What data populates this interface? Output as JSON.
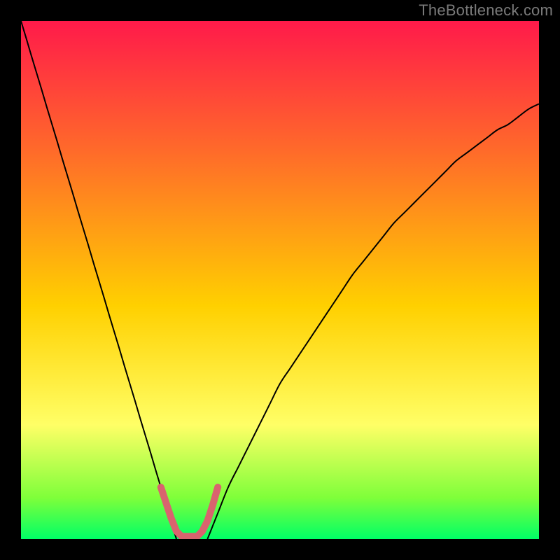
{
  "attribution": "TheBottleneck.com",
  "chart_data": {
    "type": "line",
    "title": "",
    "xlabel": "",
    "ylabel": "",
    "xlim": [
      0,
      100
    ],
    "ylim": [
      0,
      100
    ],
    "grid": false,
    "legend": false,
    "background_gradient": [
      "#ff1a4a",
      "#ff6a2a",
      "#ffd000",
      "#ffff66",
      "#7fff3a",
      "#00ff66"
    ],
    "series": [
      {
        "name": "left-branch",
        "stroke": "#000000",
        "width": 2,
        "x": [
          0,
          1,
          2,
          3,
          4,
          5,
          6,
          7,
          8,
          9,
          10,
          11,
          12,
          13,
          14,
          15,
          16,
          17,
          18,
          19,
          20,
          21,
          22,
          23,
          24,
          25,
          26,
          27,
          28,
          29,
          30
        ],
        "y": [
          100,
          96.7,
          93.3,
          90,
          86.7,
          83.3,
          80,
          76.7,
          73.3,
          70,
          66.7,
          63.3,
          60,
          56.7,
          53.3,
          50,
          46.7,
          43.3,
          40,
          36.7,
          33.3,
          30,
          26.7,
          23.3,
          20,
          16.7,
          13.3,
          10,
          6.7,
          3.3,
          0
        ]
      },
      {
        "name": "right-branch",
        "stroke": "#000000",
        "width": 2,
        "x": [
          36,
          38,
          40,
          42,
          44,
          46,
          48,
          50,
          52,
          54,
          56,
          58,
          60,
          62,
          64,
          66,
          68,
          70,
          72,
          74,
          76,
          78,
          80,
          82,
          84,
          86,
          88,
          90,
          92,
          94,
          96,
          98,
          100
        ],
        "y": [
          0,
          5,
          10,
          14,
          18,
          22,
          26,
          30,
          33,
          36,
          39,
          42,
          45,
          48,
          51,
          53.5,
          56,
          58.5,
          61,
          63,
          65,
          67,
          69,
          71,
          73,
          74.5,
          76,
          77.5,
          79,
          80,
          81.5,
          83,
          84
        ]
      },
      {
        "name": "optimal-zone-marker",
        "stroke": "#d9636e",
        "width": 10,
        "linecap": "round",
        "x": [
          27,
          28,
          29,
          30,
          31,
          32,
          33,
          34,
          35,
          36,
          37,
          38
        ],
        "y": [
          10,
          7,
          4,
          1.5,
          0.5,
          0.5,
          0.5,
          0.5,
          1.5,
          3.5,
          6.5,
          10
        ]
      }
    ]
  }
}
